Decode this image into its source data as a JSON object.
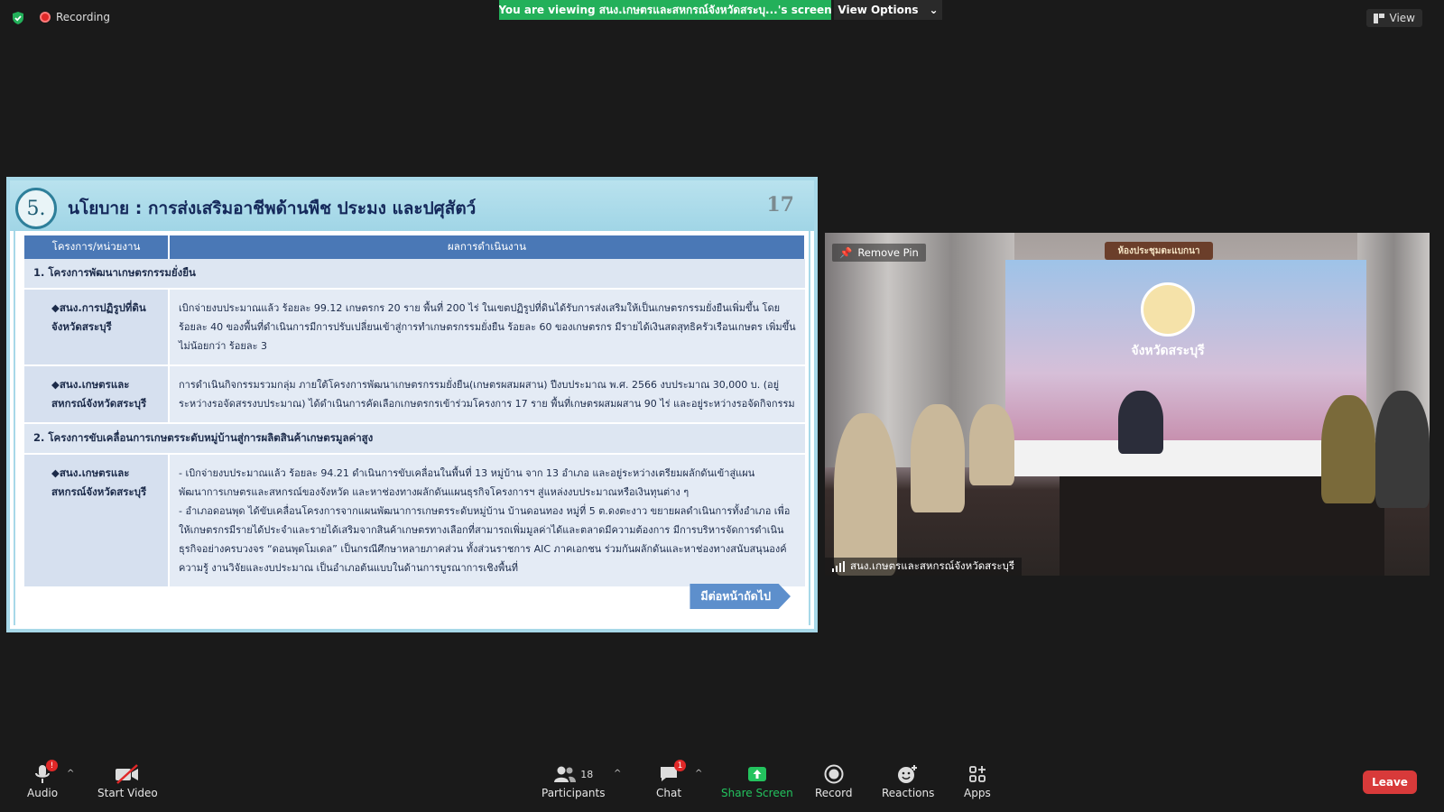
{
  "top_bar": {
    "recording_label": "Recording",
    "viewing_banner": "You are viewing สนง.เกษตรและสหกรณ์จังหวัดสระบุ...'s screen",
    "view_options_label": "View Options",
    "view_label": "View"
  },
  "slide": {
    "number": "5.",
    "title": "นโยบาย : การส่งเสริมอาชีพด้านพืช ประมง และปศุสัตว์",
    "page": "17",
    "headers": [
      "โครงการ/หน่วยงาน",
      "ผลการดำเนินงาน"
    ],
    "section1": "1. โครงการพัฒนาเกษตรกรรมยั่งยืน",
    "row1_unit": "◆สนง.การปฏิรูปที่ดินจังหวัดสระบุรี",
    "row1_detail": "เบิกจ่ายงบประมาณแล้ว ร้อยละ 99.12 เกษตรกร 20 ราย พื้นที่ 200 ไร่ ในเขตปฏิรูปที่ดินได้รับการส่งเสริมให้เป็นเกษตรกรรมยั่งยืนเพิ่มขึ้น โดยร้อยละ 40 ของพื้นที่ดำเนินการมีการปรับเปลี่ยนเข้าสู่การทำเกษตรกรรมยั่งยืน ร้อยละ 60 ของเกษตรกร มีรายได้เงินสดสุทธิครัวเรือนเกษตร เพิ่มขึ้น ไม่น้อยกว่า ร้อยละ 3",
    "row2_unit": "◆สนง.เกษตรและสหกรณ์จังหวัดสระบุรี",
    "row2_detail": "การดำเนินกิจกรรมรวมกลุ่ม ภายใต้โครงการพัฒนาเกษตรกรรมยั่งยืน(เกษตรผสมผสาน) ปีงบประมาณ พ.ศ. 2566 งบประมาณ 30,000 บ. (อยู่ระหว่างรอจัดสรรงบประมาณ) ได้ดำเนินการคัดเลือกเกษตรกรเข้าร่วมโครงการ 17 ราย พื้นที่เกษตรผสมผสาน 90 ไร่ และอยู่ระหว่างรอจัดกิจกรรม",
    "section2": "2. โครงการขับเคลื่อนการเกษตรระดับหมู่บ้านสู่การผลิตสินค้าเกษตรมูลค่าสูง",
    "row3_unit": "◆สนง.เกษตรและสหกรณ์จังหวัดสระบุรี",
    "row3_detail_a": "- เบิกจ่ายงบประมาณแล้ว ร้อยละ 94.21 ดำเนินการขับเคลื่อนในพื้นที่ 13 หมู่บ้าน จาก 13 อำเภอ และอยู่ระหว่างเตรียมผลักดันเข้าสู่แผนพัฒนาการเกษตรและสหกรณ์ของจังหวัด และหาช่องทางผลักดันแผนธุรกิจโครงการฯ สู่แหล่งงบประมาณหรือเงินทุนต่าง ๆ",
    "row3_detail_b": "- อำเภอดอนพุด ได้ขับเคลื่อนโครงการจากแผนพัฒนาการเกษตรระดับหมู่บ้าน บ้านดอนทอง หมู่ที่ 5 ต.ดงตะงาว ขยายผลดำเนินการทั้งอำเภอ เพื่อให้เกษตรกรมีรายได้ประจำและรายได้เสริมจากสินค้าเกษตรทางเลือกที่สามารถเพิ่มมูลค่าได้และตลาดมีความต้องการ มีการบริหารจัดการดำเนินธุรกิจอย่างครบวงจร “ดอนพุดโมเดล” เป็นกรณีศึกษาหลายภาคส่วน ทั้งส่วนราชการ AIC ภาคเอกชน ร่วมกันผลักดันและหาช่องทางสนับสนุนองค์ความรู้ งานวิจัยและงบประมาณ เป็นอำเภอต้นแบบในด้านการบูรณาการเชิงพื้นที่",
    "next_label": "มีต่อหน้าถัดไป"
  },
  "video": {
    "remove_pin_label": "Remove Pin",
    "participant_name": "สนง.เกษตรและสหกรณ์จังหวัดสระบุรี",
    "room_sign": "ห้องประชุมตะแบกนา",
    "emblem_text": "จังหวัดสระบุรี"
  },
  "toolbar": {
    "audio": "Audio",
    "audio_badge": "!",
    "start_video": "Start Video",
    "participants": "Participants",
    "participant_count": "18",
    "chat": "Chat",
    "chat_badge": "1",
    "share_screen": "Share Screen",
    "record": "Record",
    "reactions": "Reactions",
    "apps": "Apps",
    "leave": "Leave"
  },
  "colors": {
    "banner_green": "#23b05a",
    "leave_red": "#d83a3a",
    "header_blue": "#4a78b6"
  }
}
